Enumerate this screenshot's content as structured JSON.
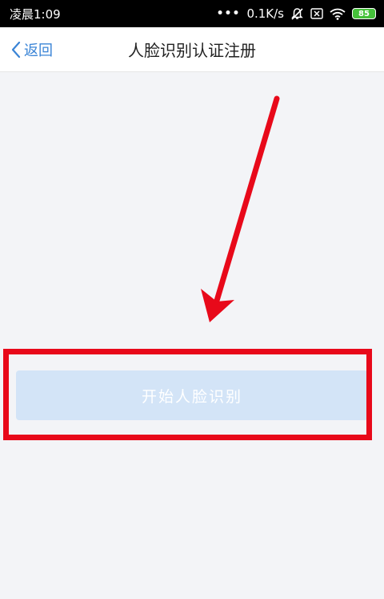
{
  "status_bar": {
    "time": "凌晨1:09",
    "dots": "•••",
    "network_speed": "0.1K/s",
    "battery_level": "85",
    "icons": [
      "mute-bell-icon",
      "sim-off-icon",
      "wifi-icon",
      "battery-icon"
    ]
  },
  "nav": {
    "back_label": "返回",
    "title": "人脸识别认证注册"
  },
  "main": {
    "start_button_label": "开始人脸识别"
  },
  "annotations": {
    "arrow_color": "#e8091a",
    "box_color": "#e8091a"
  },
  "colors": {
    "accent": "#3a84d6",
    "button_bg": "#d3e4f7",
    "page_bg": "#f3f4f7"
  }
}
